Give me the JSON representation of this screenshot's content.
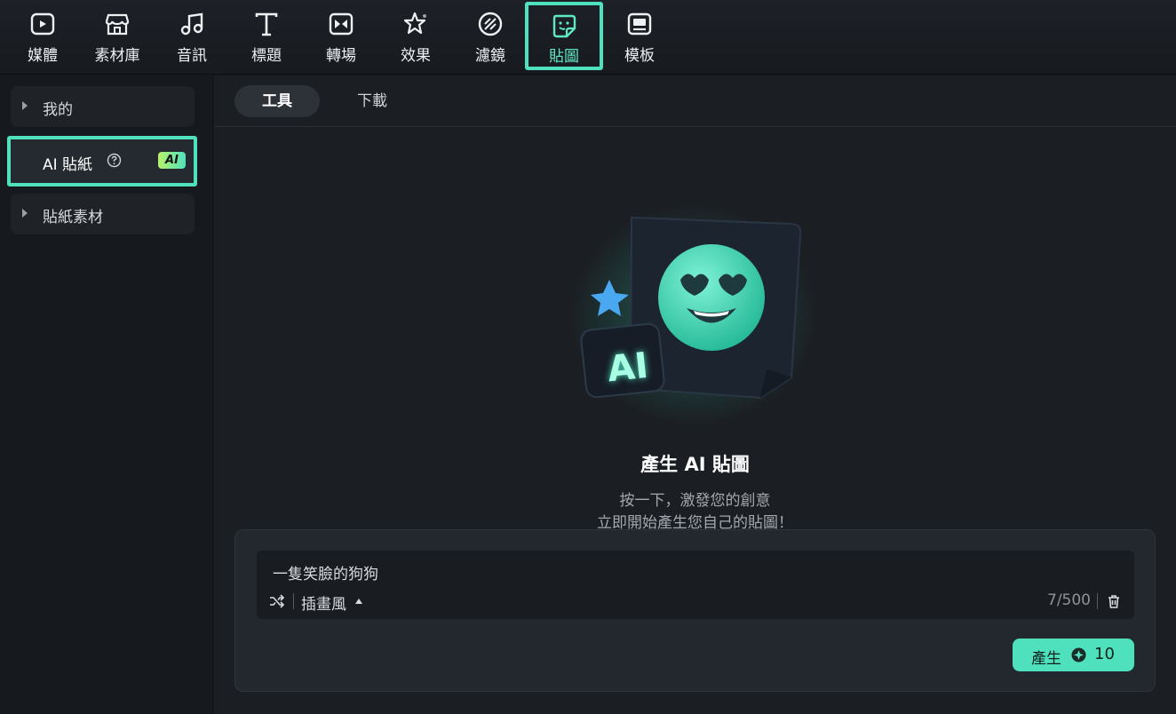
{
  "toolbar": {
    "items": [
      {
        "label": "媒體",
        "icon": "media-icon"
      },
      {
        "label": "素材庫",
        "icon": "store-icon"
      },
      {
        "label": "音訊",
        "icon": "music-note-icon"
      },
      {
        "label": "標題",
        "icon": "text-icon"
      },
      {
        "label": "轉場",
        "icon": "transition-icon"
      },
      {
        "label": "效果",
        "icon": "effects-star-icon"
      },
      {
        "label": "濾鏡",
        "icon": "filter-icon"
      },
      {
        "label": "貼圖",
        "icon": "sticker-icon"
      },
      {
        "label": "模板",
        "icon": "template-icon"
      }
    ],
    "active": "貼圖",
    "accent_color": "#4fe1bd"
  },
  "sidebar": {
    "items": [
      {
        "label": "我的"
      },
      {
        "label": "AI 貼紙",
        "badge": "AI"
      },
      {
        "label": "貼紙素材"
      }
    ]
  },
  "tabs": [
    {
      "label": "工具"
    },
    {
      "label": "下載"
    }
  ],
  "hero": {
    "badge_text": "AI",
    "title": "產生 AI 貼圖",
    "subtitle_line1": "按一下，激發您的創意",
    "subtitle_line2": "立即開始產生您自己的貼圖！"
  },
  "input": {
    "prompt": "一隻笑臉的狗狗",
    "style": "插畫風",
    "count": "7/500"
  },
  "generate_button": {
    "label": "產生",
    "cost": "10"
  }
}
